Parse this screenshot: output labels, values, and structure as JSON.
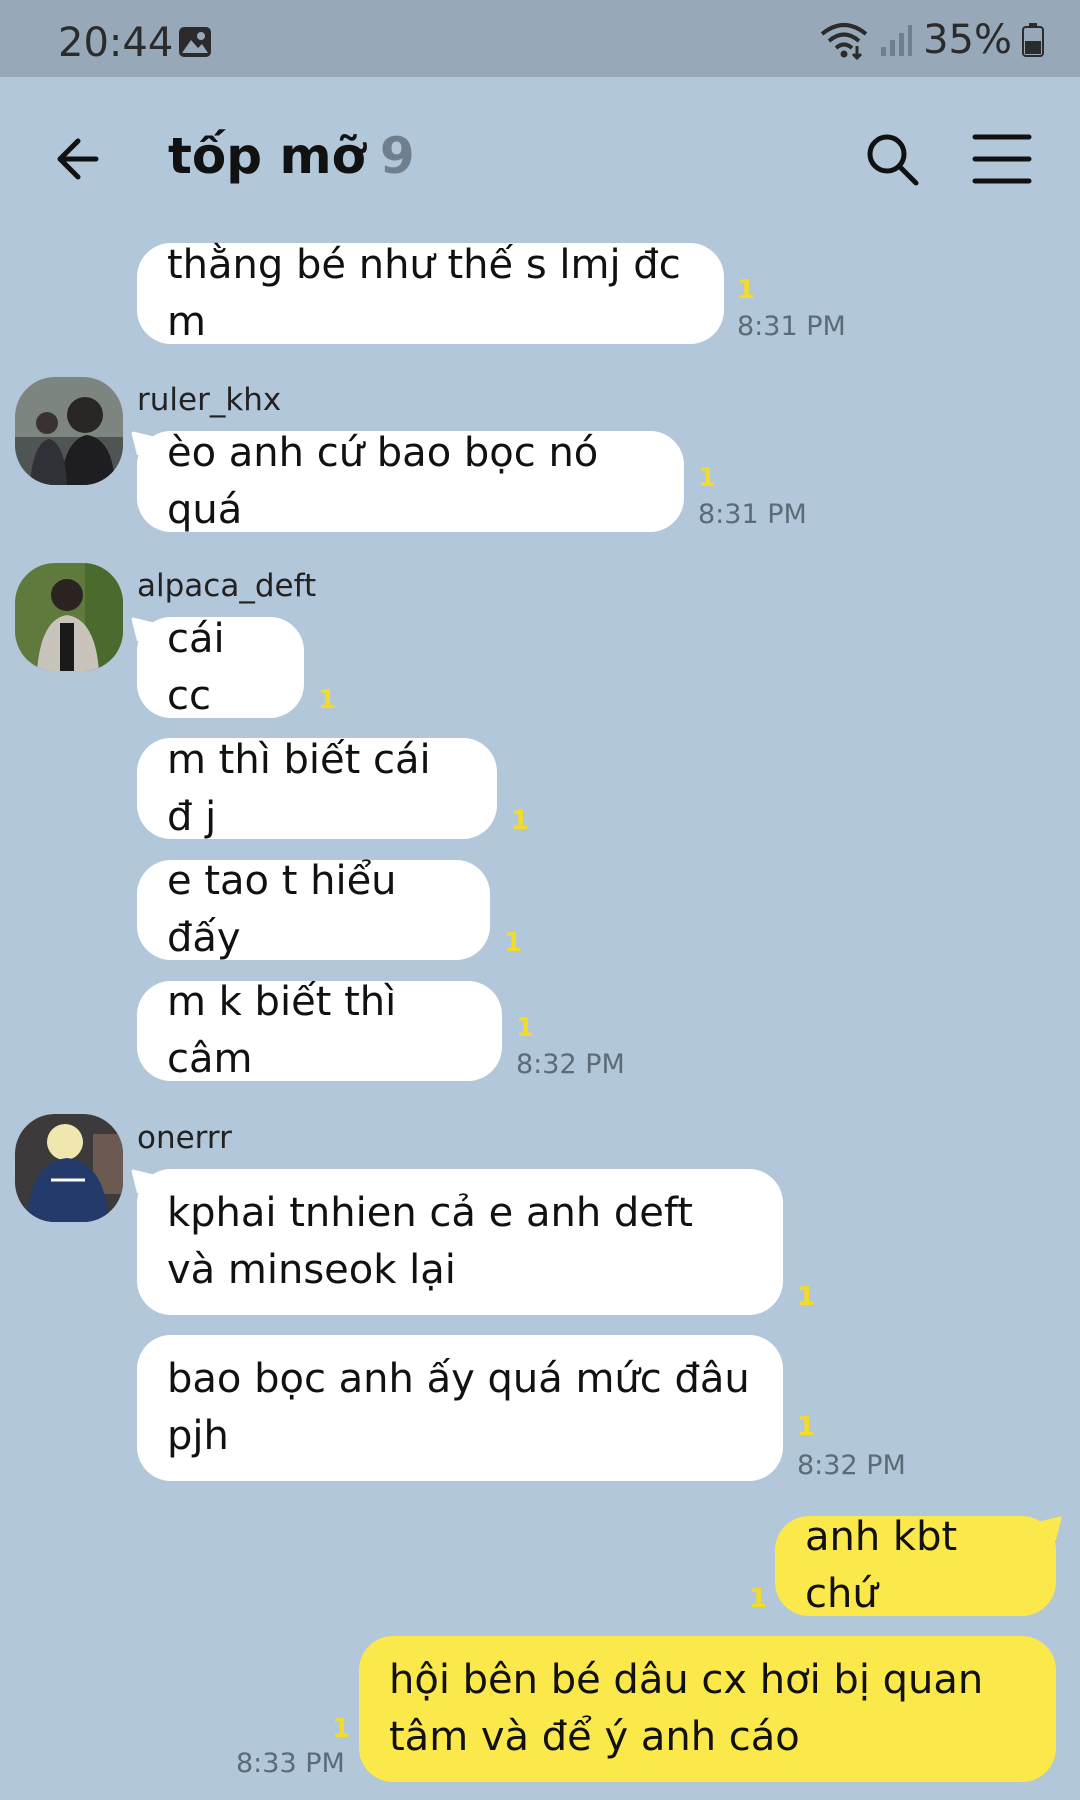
{
  "status_bar": {
    "time": "20:44",
    "battery": "35%"
  },
  "header": {
    "title": "tốp mỡ",
    "member_count": "9"
  },
  "messages": [
    {
      "text": "thằng bé như thế s lmj đc m",
      "unread": "1",
      "time": "8:31 PM"
    },
    {
      "sender": "ruler_khx",
      "text": "èo anh cứ bao bọc nó quá",
      "unread": "1",
      "time": "8:31 PM"
    },
    {
      "sender": "alpaca_deft",
      "text": "cái cc",
      "unread": "1"
    },
    {
      "text": "m thì biết cái đ j",
      "unread": "1"
    },
    {
      "text": "e tao t hiểu đấy",
      "unread": "1"
    },
    {
      "text": "m k biết thì câm",
      "unread": "1",
      "time": "8:32 PM"
    },
    {
      "sender": "onerrr",
      "text": "kphai tnhien cả e anh deft và minseok lại",
      "unread": "1"
    },
    {
      "text": "bao bọc anh ấy quá mức đâu pjh",
      "unread": "1",
      "time": "8:32 PM"
    },
    {
      "own": true,
      "text": "anh kbt chứ",
      "unread": "1"
    },
    {
      "own": true,
      "text": "hội bên bé dâu cx hơi bị quan tâm và để ý anh cáo",
      "unread": "1",
      "time": "8:33 PM"
    }
  ],
  "colors": {
    "background": "#b2c7d9",
    "status_bar": "#97a9b9",
    "incoming_bubble": "#ffffff",
    "outgoing_bubble": "#fbe84a",
    "unread_count": "#f2dc2a"
  },
  "icons": {
    "back": "arrow-left-icon",
    "search": "search-icon",
    "menu": "hamburger-menu-icon",
    "status_image": "image-icon",
    "wifi": "wifi-icon",
    "signal": "signal-icon",
    "battery": "battery-icon"
  }
}
